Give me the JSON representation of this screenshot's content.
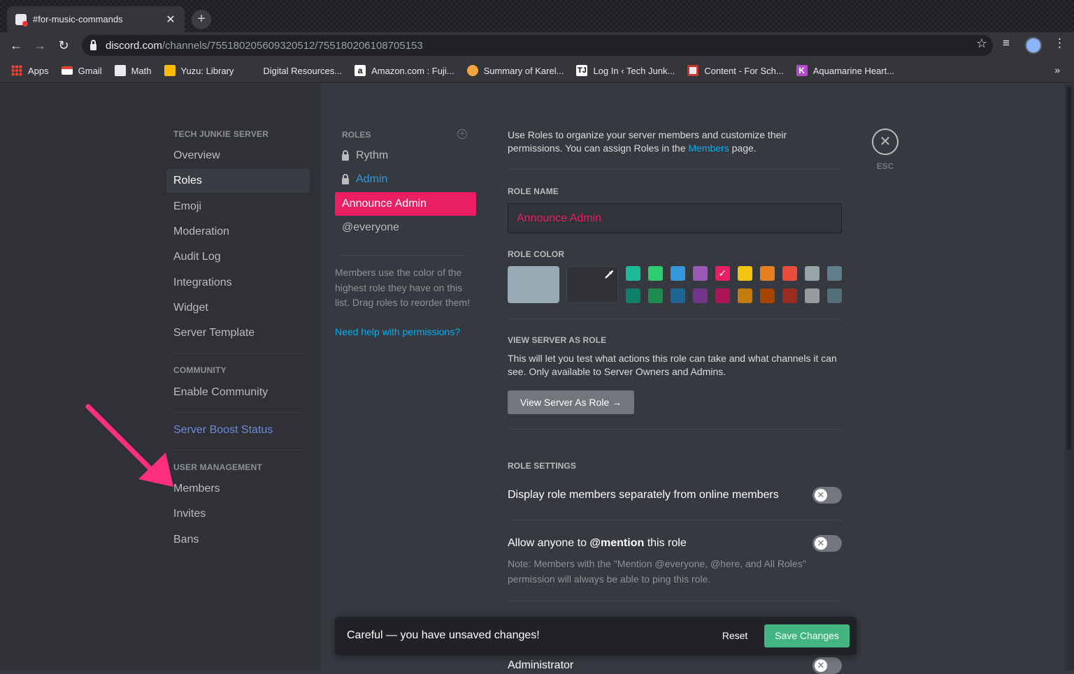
{
  "browser": {
    "tab_title": "#for-music-commands",
    "url_host": "discord.com",
    "url_path": "/channels/755180205609320512/755180206108705153",
    "bookmarks": [
      {
        "label": "Apps",
        "color": "#4285f4"
      },
      {
        "label": "Gmail",
        "color": "#ea4335"
      },
      {
        "label": "Math",
        "color": "#e8eaed"
      },
      {
        "label": "Yuzu: Library",
        "color": "#fbbc04"
      },
      {
        "label": "Digital Resources...",
        "color": ""
      },
      {
        "label": "Amazon.com : Fuji...",
        "color": "#ffffff"
      },
      {
        "label": "Summary of Karel...",
        "color": "#f4a340"
      },
      {
        "label": "Log In ‹ Tech Junk...",
        "color": "#ffffff"
      },
      {
        "label": "Content - For Sch...",
        "color": "#e8eaed"
      },
      {
        "label": "Aquamarine Heart...",
        "color": "#b14bc9"
      }
    ],
    "more": "»"
  },
  "sidebar": {
    "server_heading": "TECH JUNKIE SERVER",
    "items": [
      "Overview",
      "Roles",
      "Emoji",
      "Moderation",
      "Audit Log",
      "Integrations",
      "Widget",
      "Server Template"
    ],
    "community_heading": "COMMUNITY",
    "community_items": [
      "Enable Community"
    ],
    "boost": "Server Boost Status",
    "user_heading": "USER MANAGEMENT",
    "user_items": [
      "Members",
      "Invites",
      "Bans"
    ]
  },
  "roles": {
    "heading": "ROLES",
    "list": [
      "Rythm",
      "Admin",
      "Announce Admin",
      "@everyone"
    ],
    "help": "Members use the color of the highest role they have on this list. Drag roles to reorder them!",
    "help_link": "Need help with permissions?",
    "colors": {
      "rythm": "#b9bbbe",
      "admin": "#3498db",
      "active": "#e91e63"
    }
  },
  "main": {
    "intro_1": "Use Roles to organize your server members and customize their permissions. You can assign Roles in the",
    "intro_link": "Members",
    "intro_2": "page.",
    "role_name_label": "ROLE NAME",
    "role_name_value": "Announce Admin",
    "role_color_label": "ROLE COLOR",
    "swatches_top": [
      "#1abc9c",
      "#2ecc71",
      "#3498db",
      "#9b59b6",
      "#e91e63",
      "#f1c40f",
      "#e67e22",
      "#e74c3c",
      "#95a5a6",
      "#607d8b"
    ],
    "swatches_bottom": [
      "#11806a",
      "#1f8b4c",
      "#206694",
      "#71368a",
      "#ad1457",
      "#c27c0e",
      "#a84300",
      "#992d22",
      "#979c9f",
      "#546e7a"
    ],
    "default_color": "#99aab5",
    "view_as_label": "VIEW SERVER AS ROLE",
    "view_as_text": "This will let you test what actions this role can take and what channels it can see. Only available to Server Owners and Admins.",
    "view_as_button": "View Server As Role →",
    "settings_label": "ROLE SETTINGS",
    "setting_1": "Display role members separately from online members",
    "setting_2_a": "Allow anyone to",
    "setting_2_b": "@mention",
    "setting_2_c": "this role",
    "setting_2_note": "Note: Members with the \"Mention @everyone, @here, and All Roles\" permission will always be able to ping this role.",
    "setting_3": "Administrator",
    "esc": "ESC"
  },
  "notice": {
    "text": "Careful — you have unsaved changes!",
    "reset": "Reset",
    "save": "Save Changes"
  }
}
